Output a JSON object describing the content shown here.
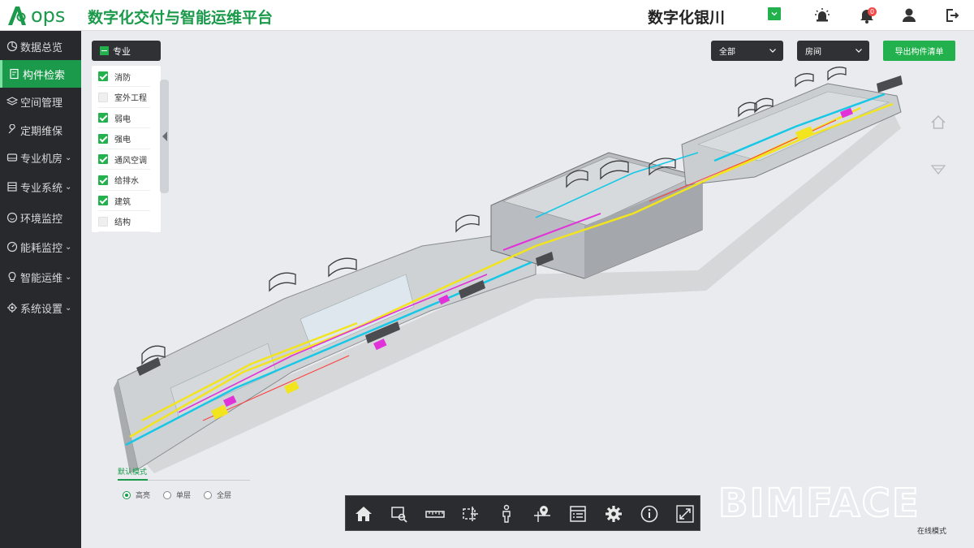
{
  "header": {
    "logo_mark": "A",
    "logo_text": "ops",
    "app_title": "数字化交付与智能运维平台",
    "project_name": "数字化银川",
    "notification_count": "0",
    "accent": "#1a9a4a"
  },
  "sidebar": {
    "items": [
      {
        "label": "数据总览",
        "icon": "pie-chart-icon",
        "chevron": ""
      },
      {
        "label": "构件检索",
        "icon": "document-search-icon",
        "chevron": ""
      },
      {
        "label": "空间管理",
        "icon": "layers-icon",
        "chevron": ""
      },
      {
        "label": "定期维保",
        "icon": "wrench-icon",
        "chevron": ""
      },
      {
        "label": "专业机房",
        "icon": "server-icon",
        "chevron": "⌄"
      },
      {
        "label": "专业系统",
        "icon": "list-icon",
        "chevron": "⌄"
      },
      {
        "label": "环境监控",
        "icon": "smile-icon",
        "chevron": ""
      },
      {
        "label": "能耗监控",
        "icon": "gauge-icon",
        "chevron": "⌄"
      },
      {
        "label": "智能运维",
        "icon": "bulb-icon",
        "chevron": "⌄"
      },
      {
        "label": "系统设置",
        "icon": "gear-icon",
        "chevron": "⌄"
      }
    ],
    "active_index": 1
  },
  "filters": {
    "discipline_label": "专业",
    "disciplines": [
      {
        "label": "消防",
        "checked": true
      },
      {
        "label": "室外工程",
        "checked": false
      },
      {
        "label": "弱电",
        "checked": true
      },
      {
        "label": "强电",
        "checked": true
      },
      {
        "label": "通风空调",
        "checked": true
      },
      {
        "label": "给排水",
        "checked": true
      },
      {
        "label": "建筑",
        "checked": true
      },
      {
        "label": "结构",
        "checked": false
      }
    ],
    "floor_select": "全部",
    "type_select": "房间",
    "export_label": "导出构件清单"
  },
  "display_mode": {
    "tab_label": "默认模式",
    "options": [
      "高亮",
      "单层",
      "全层"
    ],
    "selected": 0
  },
  "toolbar": {
    "tools": [
      "home-icon",
      "zoom-box-icon",
      "ruler-icon",
      "section-box-icon",
      "person-walk-icon",
      "map-pin-icon",
      "properties-icon",
      "gear-icon",
      "info-icon",
      "fullscreen-icon"
    ]
  },
  "viewer": {
    "watermark": "BIMFACE",
    "mode_text": "在线模式"
  }
}
